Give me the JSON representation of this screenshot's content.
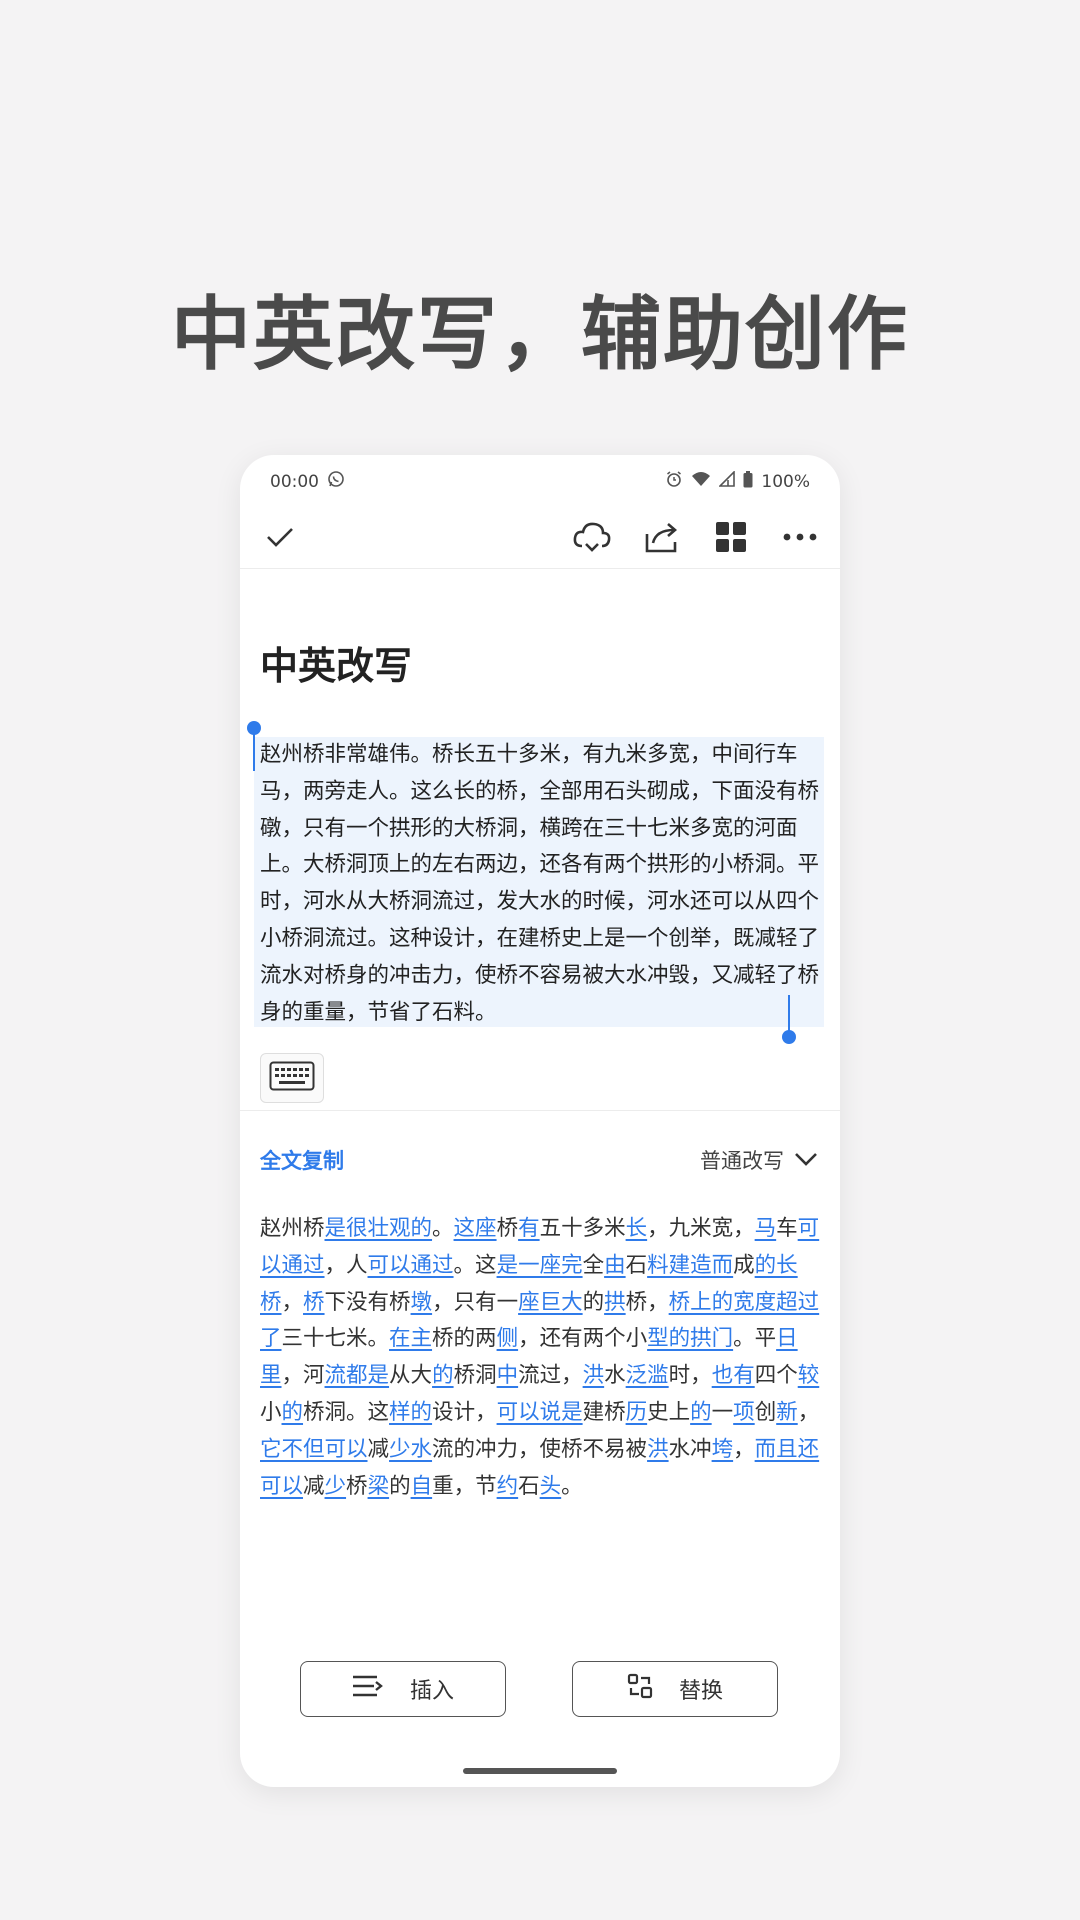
{
  "headline": "中英改写，辅助创作",
  "status_bar": {
    "time": "00:00",
    "battery": "100%",
    "icons": [
      "whatsapp-icon",
      "alarm-icon",
      "wifi-icon",
      "signal-icon",
      "battery-icon"
    ]
  },
  "toolbar": {
    "icons": [
      "check-icon",
      "cloud-sync-icon",
      "share-icon",
      "grid-icon",
      "more-icon"
    ]
  },
  "document": {
    "title": "中英改写",
    "selected_text": "赵州桥非常雄伟。桥长五十多米，有九米多宽，中间行车马，两旁走人。这么长的桥，全部用石头砌成，下面没有桥礅，只有一个拱形的大桥洞，横跨在三十七米多宽的河面上。大桥洞顶上的左右两边，还各有两个拱形的小桥洞。平时，河水从大桥洞流过，发大水的时候，河水还可以从四个小桥洞流过。这种设计，在建桥史上是一个创举，既减轻了流水对桥身的冲击力，使桥不容易被大水冲毁，又减轻了桥身的重量，节省了石料。"
  },
  "rewrite_panel": {
    "copy_all": "全文复制",
    "mode": "普通改写",
    "segments": [
      {
        "t": "赵州桥",
        "h": false
      },
      {
        "t": "是很壮观的",
        "h": true
      },
      {
        "t": "。",
        "h": false
      },
      {
        "t": "这座",
        "h": true
      },
      {
        "t": "桥",
        "h": false
      },
      {
        "t": "有",
        "h": true
      },
      {
        "t": "五十多米",
        "h": false
      },
      {
        "t": "长",
        "h": true
      },
      {
        "t": "，九米宽，",
        "h": false
      },
      {
        "t": "马",
        "h": true
      },
      {
        "t": "车",
        "h": false
      },
      {
        "t": "可以通过",
        "h": true
      },
      {
        "t": "，人",
        "h": false
      },
      {
        "t": "可以通过",
        "h": true
      },
      {
        "t": "。这",
        "h": false
      },
      {
        "t": "是一座完",
        "h": true
      },
      {
        "t": "全",
        "h": false
      },
      {
        "t": "由",
        "h": true
      },
      {
        "t": "石",
        "h": false
      },
      {
        "t": "料建造而",
        "h": true
      },
      {
        "t": "成",
        "h": false
      },
      {
        "t": "的长桥",
        "h": true
      },
      {
        "t": "，",
        "h": false
      },
      {
        "t": "桥",
        "h": true
      },
      {
        "t": "下没有桥",
        "h": false
      },
      {
        "t": "墩",
        "h": true
      },
      {
        "t": "，只有一",
        "h": false
      },
      {
        "t": "座巨大",
        "h": true
      },
      {
        "t": "的",
        "h": false
      },
      {
        "t": "拱",
        "h": true
      },
      {
        "t": "桥，",
        "h": false
      },
      {
        "t": "桥上的宽度超过了",
        "h": true
      },
      {
        "t": "三十七米。",
        "h": false
      },
      {
        "t": "在主",
        "h": true
      },
      {
        "t": "桥的两",
        "h": false
      },
      {
        "t": "侧",
        "h": true
      },
      {
        "t": "，还有两个小",
        "h": false
      },
      {
        "t": "型的拱门",
        "h": true
      },
      {
        "t": "。平",
        "h": false
      },
      {
        "t": "日里",
        "h": true
      },
      {
        "t": "，河",
        "h": false
      },
      {
        "t": "流都是",
        "h": true
      },
      {
        "t": "从大",
        "h": false
      },
      {
        "t": "的",
        "h": true
      },
      {
        "t": "桥洞",
        "h": false
      },
      {
        "t": "中",
        "h": true
      },
      {
        "t": "流过，",
        "h": false
      },
      {
        "t": "洪",
        "h": true
      },
      {
        "t": "水",
        "h": false
      },
      {
        "t": "泛滥",
        "h": true
      },
      {
        "t": "时，",
        "h": false
      },
      {
        "t": "也有",
        "h": true
      },
      {
        "t": "四个",
        "h": false
      },
      {
        "t": "较",
        "h": true
      },
      {
        "t": "小",
        "h": false
      },
      {
        "t": "的",
        "h": true
      },
      {
        "t": "桥洞。这",
        "h": false
      },
      {
        "t": "样的",
        "h": true
      },
      {
        "t": "设计，",
        "h": false
      },
      {
        "t": "可以说是",
        "h": true
      },
      {
        "t": "建桥",
        "h": false
      },
      {
        "t": "历",
        "h": true
      },
      {
        "t": "史上",
        "h": false
      },
      {
        "t": "的",
        "h": true
      },
      {
        "t": "一",
        "h": false
      },
      {
        "t": "项",
        "h": true
      },
      {
        "t": "创",
        "h": false
      },
      {
        "t": "新",
        "h": true
      },
      {
        "t": "，",
        "h": false
      },
      {
        "t": "它不但可以",
        "h": true
      },
      {
        "t": "减",
        "h": false
      },
      {
        "t": "少水",
        "h": true
      },
      {
        "t": "流的冲力，使桥不易被",
        "h": false
      },
      {
        "t": "洪",
        "h": true
      },
      {
        "t": "水冲",
        "h": false
      },
      {
        "t": "垮",
        "h": true
      },
      {
        "t": "，",
        "h": false
      },
      {
        "t": "而且还可以",
        "h": true
      },
      {
        "t": "减",
        "h": false
      },
      {
        "t": "少",
        "h": true
      },
      {
        "t": "桥",
        "h": false
      },
      {
        "t": "梁",
        "h": true
      },
      {
        "t": "的",
        "h": false
      },
      {
        "t": "自",
        "h": true
      },
      {
        "t": "重，节",
        "h": false
      },
      {
        "t": "约",
        "h": true
      },
      {
        "t": "石",
        "h": false
      },
      {
        "t": "头",
        "h": true
      },
      {
        "t": "。",
        "h": false
      }
    ]
  },
  "actions": {
    "insert": "插入",
    "replace": "替换"
  },
  "colors": {
    "accent": "#2f7bea",
    "selection_bg": "#edf4fd",
    "page_bg": "#f4f3f4"
  }
}
